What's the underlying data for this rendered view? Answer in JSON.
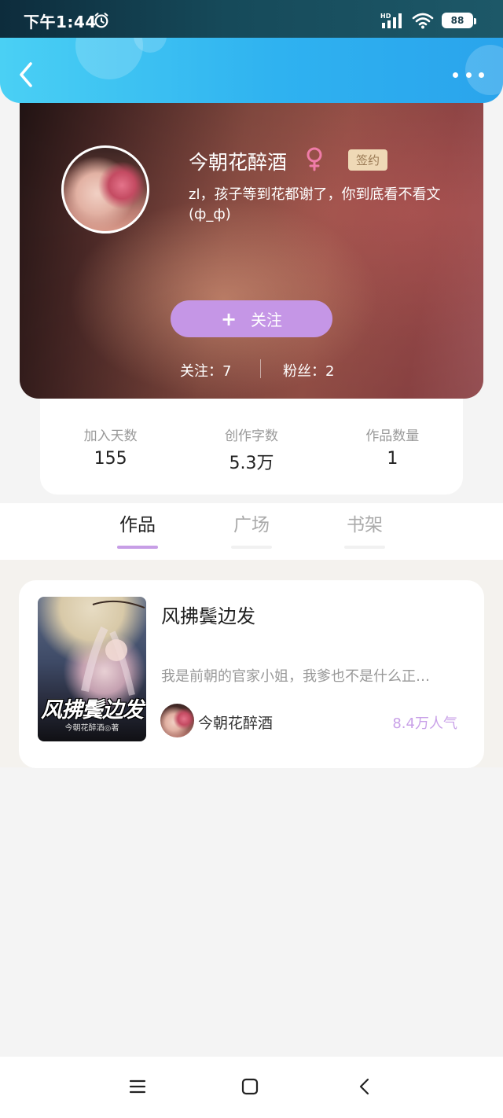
{
  "status_bar": {
    "time": "下午1:44",
    "network": "HD",
    "battery": "88",
    "icons": [
      "alarm-icon",
      "signal-icon",
      "wifi-icon",
      "battery-icon"
    ]
  },
  "header": {
    "back_icon": "back-arrow-icon",
    "more_icon": "more-icon"
  },
  "profile": {
    "name": "今朝花醉酒",
    "gender_icon": "female-icon",
    "tag": "签约",
    "bio": "zl，孩子等到花都谢了，你到底看不看文(ф_ф)",
    "follow_button": "关注",
    "follow_count": "关注：7",
    "fans_count": "粉丝：2"
  },
  "stats": [
    {
      "label": "加入天数",
      "value": "155"
    },
    {
      "label": "创作字数",
      "value": "5.3万"
    },
    {
      "label": "作品数量",
      "value": "1"
    }
  ],
  "tabs": [
    {
      "label": "作品",
      "active": true
    },
    {
      "label": "广场",
      "active": false
    },
    {
      "label": "书架",
      "active": false
    }
  ],
  "book": {
    "title": "风拂鬓边发",
    "cover_title": "风拂鬓边发",
    "cover_author": "今朝花醉酒◎著",
    "description": "我是前朝的官家小姐，我爹也不是什么正…",
    "author": "今朝花醉酒",
    "popularity": "8.4万人气"
  },
  "nav": [
    "menu-icon",
    "home-icon",
    "back-icon"
  ],
  "colors": {
    "header_blue": "#2fb2f0",
    "accent_purple": "#c596e6",
    "tag_bg": "#efd9b6",
    "female_pink": "#f07ca8"
  }
}
